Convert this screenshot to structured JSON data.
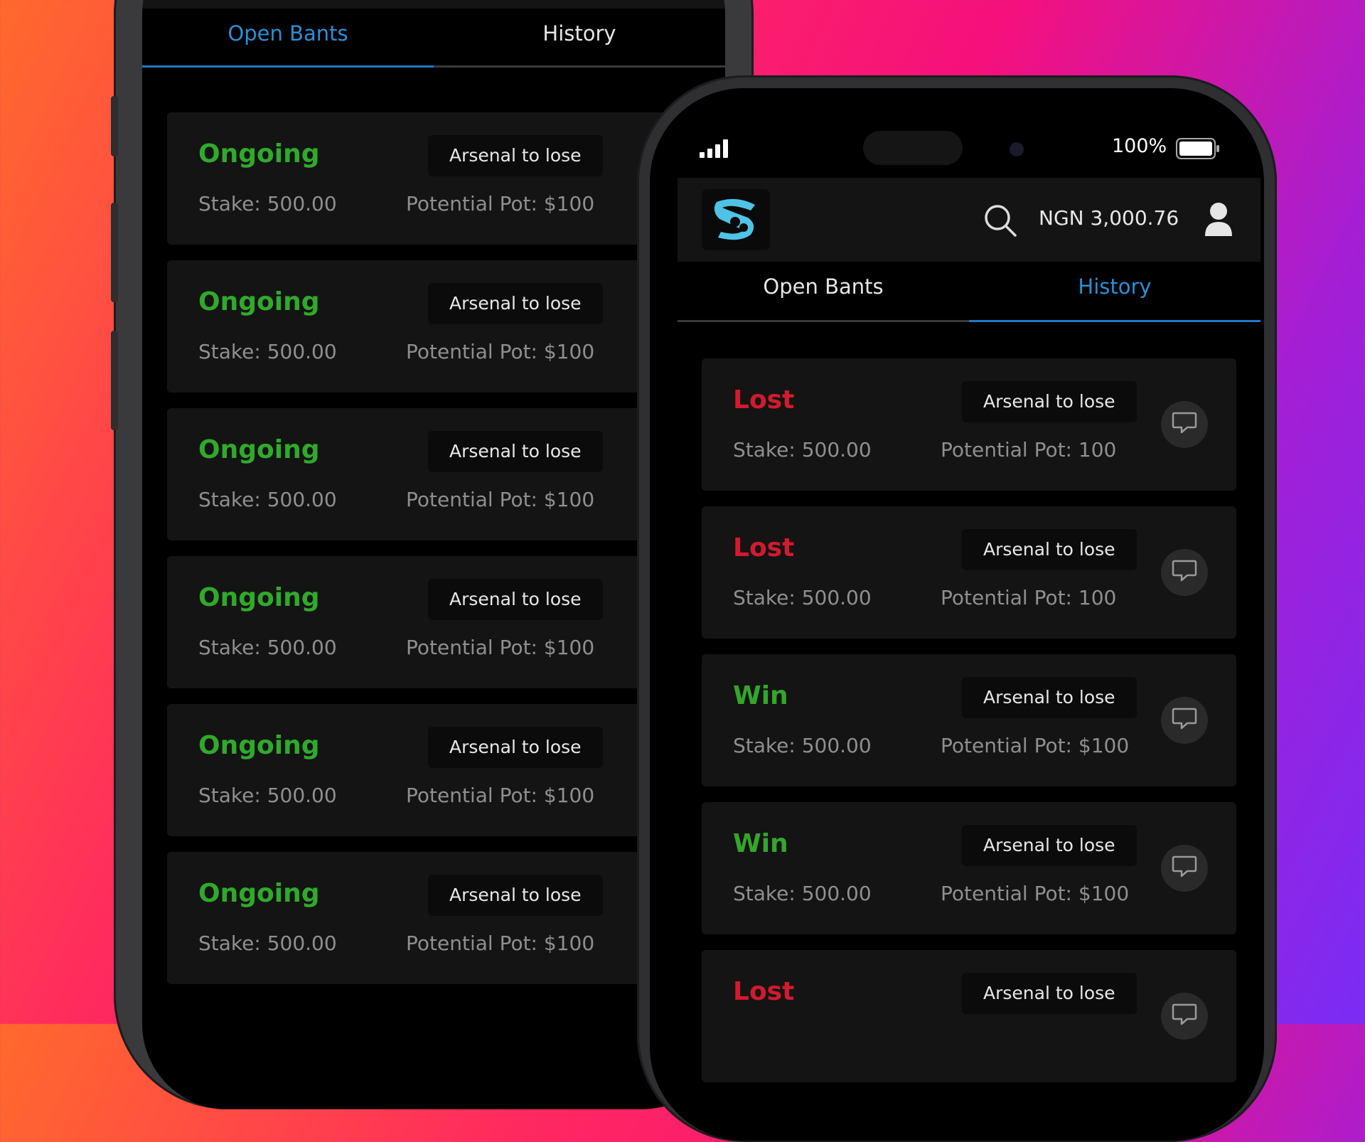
{
  "back_screen": {
    "tabs": [
      {
        "label": "Open Bants",
        "active": true
      },
      {
        "label": "History",
        "active": false
      }
    ],
    "cards": [
      {
        "status": "Ongoing",
        "pick": "Arsenal to lose",
        "stake": "Stake: 500.00",
        "pot": "Potential Pot: $100"
      },
      {
        "status": "Ongoing",
        "pick": "Arsenal to lose",
        "stake": "Stake: 500.00",
        "pot": "Potential Pot: $100"
      },
      {
        "status": "Ongoing",
        "pick": "Arsenal to lose",
        "stake": "Stake: 500.00",
        "pot": "Potential Pot: $100"
      },
      {
        "status": "Ongoing",
        "pick": "Arsenal to lose",
        "stake": "Stake: 500.00",
        "pot": "Potential Pot: $100"
      },
      {
        "status": "Ongoing",
        "pick": "Arsenal to lose",
        "stake": "Stake: 500.00",
        "pot": "Potential Pot: $100"
      },
      {
        "status": "Ongoing",
        "pick": "Arsenal to lose",
        "stake": "Stake: 500.00",
        "pot": "Potential Pot: $100"
      }
    ]
  },
  "front_screen": {
    "status_bar": {
      "battery": "100%",
      "signal_icon": "signal-bars-icon",
      "battery_icon": "battery-icon"
    },
    "header": {
      "balance": "NGN 3,000.76",
      "logo_icon": "app-logo-icon",
      "search_icon": "search-icon",
      "profile_icon": "user-profile-icon"
    },
    "tabs": [
      {
        "label": "Open Bants",
        "active": false
      },
      {
        "label": "History",
        "active": true
      }
    ],
    "cards": [
      {
        "status": "Lost",
        "pick": "Arsenal to lose",
        "stake": "Stake: 500.00",
        "pot": "Potential Pot: 100"
      },
      {
        "status": "Lost",
        "pick": "Arsenal to lose",
        "stake": "Stake: 500.00",
        "pot": "Potential Pot: 100"
      },
      {
        "status": "Win",
        "pick": "Arsenal to lose",
        "stake": "Stake: 500.00",
        "pot": "Potential Pot: $100"
      },
      {
        "status": "Win",
        "pick": "Arsenal to lose",
        "stake": "Stake: 500.00",
        "pot": "Potential Pot: $100"
      },
      {
        "status": "Lost",
        "pick": "Arsenal to lose",
        "stake": "",
        "pot": ""
      }
    ]
  },
  "colors": {
    "accent": "#2a8fd6",
    "ongoing": "#2faa2a",
    "win": "#34a62b",
    "lost": "#d21a2e",
    "logo": "#4fc3e6"
  }
}
